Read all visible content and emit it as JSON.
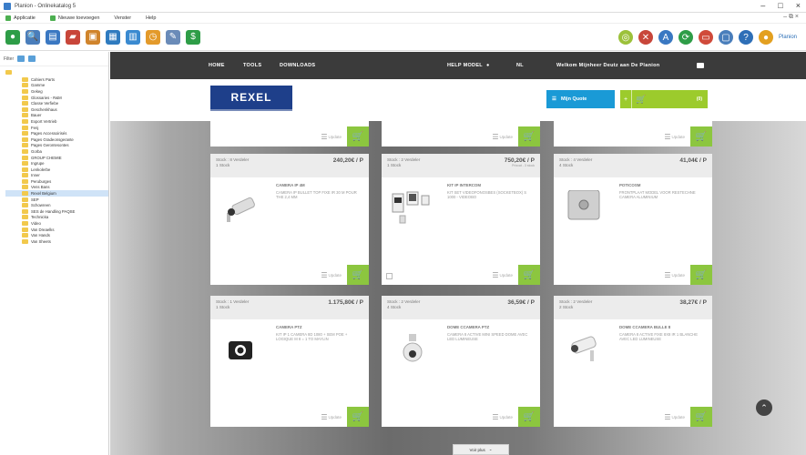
{
  "window": {
    "title": "Planion - Onlinekatalog 5",
    "controls": [
      "–",
      "□",
      "×"
    ]
  },
  "menu": {
    "items": [
      "Applicatie",
      "Nieuwe toevoegen",
      "Venster",
      "Help"
    ],
    "mdi_controls": "– ⧉ ×"
  },
  "toolbar": {
    "icons": [
      {
        "name": "home-icon",
        "color": "#2e9d47",
        "glyph": "●"
      },
      {
        "name": "search-icon",
        "color": "#4a7ebb",
        "glyph": "🔍"
      },
      {
        "name": "catalog-icon",
        "color": "#3a78c2",
        "glyph": "▤"
      },
      {
        "name": "truck-icon",
        "color": "#c8463a",
        "glyph": "▰"
      },
      {
        "name": "package-icon",
        "color": "#d0842c",
        "glyph": "▣"
      },
      {
        "name": "grid-icon",
        "color": "#2f7bbf",
        "glyph": "▦"
      },
      {
        "name": "chart-icon",
        "color": "#3a8ad0",
        "glyph": "▥"
      },
      {
        "name": "clock-icon",
        "color": "#e39a2b",
        "glyph": "◷"
      },
      {
        "name": "edit-icon",
        "color": "#6a8bb8",
        "glyph": "✎"
      },
      {
        "name": "currency-icon",
        "color": "#2e9d47",
        "glyph": "$"
      }
    ],
    "right_icons": [
      {
        "name": "lifebuoy-icon",
        "color": "#9cc13a",
        "glyph": "◎"
      },
      {
        "name": "cancel-icon",
        "color": "#c8463a",
        "glyph": "✕"
      },
      {
        "name": "language-icon",
        "color": "#3a78c2",
        "glyph": "A"
      },
      {
        "name": "sync-icon",
        "color": "#2e9d47",
        "glyph": "⟳"
      },
      {
        "name": "calendar-icon",
        "color": "#d04a3a",
        "glyph": "▭"
      },
      {
        "name": "document-icon",
        "color": "#4a7ebb",
        "glyph": "▢"
      },
      {
        "name": "help-icon",
        "color": "#2e6fb7",
        "glyph": "?"
      },
      {
        "name": "plugin-icon",
        "color": "#e3a020",
        "glyph": "●"
      }
    ],
    "right_label": "Planion"
  },
  "tree": {
    "filter_label": "Filter",
    "root_label": "",
    "items": [
      "Cahiers Parts",
      "Gamme",
      "Gekeg",
      "Glossaries - R&M",
      "Classe Verfiebe",
      "Geschenkhaus",
      "Bauer",
      "Export Vertrieb",
      "Fenj",
      "Pages Accessoirisés",
      "Pages Gradeonsgerante",
      "Pages Gerontesontes",
      "Gorba",
      "GROUP CHEMIE",
      "Ingrupe",
      "Lenkolerbe",
      "Inner",
      "Peruburges",
      "Vens Bans",
      "Rexel Belgium",
      "SEP",
      "Schowreen",
      "SES de Handling PAQSE",
      "Technicka",
      "Video",
      "Van Dreaelks",
      "Van Hands",
      "Van Sheets"
    ],
    "selected_index": 19
  },
  "nav": {
    "home": "HOME",
    "tools": "TOOLS",
    "downloads": "DOWNLOADS",
    "help": "HELP MODEL",
    "lang": "NL",
    "welcome": "Welkom Mijnheer Deutz aan De Planion"
  },
  "header": {
    "logo": "REXEL",
    "my_quote": "Mijn Quote",
    "cart_count": "(0)"
  },
  "cards": [
    {
      "stock": "Stock : 8 Verdeler",
      "stock2": "1 Stock",
      "price": "240,20€ / P",
      "price_note": "",
      "ref": "CAMERA IP 4M",
      "desc": "CAMERA IP BULLET TOP FIXE IR 30 M POUR THE 2,4 MM",
      "img": "camera-bullet"
    },
    {
      "stock": "Stock : 2 Verdeler",
      "stock2": "1 Stock",
      "price": "750,20€ / P",
      "price_note": "Prixcat - 3 stock",
      "ref": "KIT IP INTERCOM",
      "desc": "KIT SET VIDEOFONOSBES (SOCKETBOX) S 1000 - VIDEOBO",
      "img": "intercom-kit"
    },
    {
      "stock": "Stock : 4 Verdeler",
      "stock2": "4 Stock",
      "price": "41,04€ / P",
      "price_note": "",
      "ref": "POTICOSM",
      "desc": "FRONTPLAAT MODEL VOOR RESTECHNE CAMERA ALUMINIUM",
      "img": "front-plate"
    },
    {
      "stock": "Stock : 1 Verdeler",
      "stock2": "1 Stock",
      "price": "1.175,80€ / P",
      "price_note": "",
      "ref": "CAMERA PTZ",
      "desc": "KIT IP 1 CAMERA 8D 1080 + SEM POE + LOGIQUE M 8 = 1 TO MAYLIN",
      "img": "camera-box"
    },
    {
      "stock": "Stock : 2 Verdeler",
      "stock2": "4 Stock",
      "price": "36,59€ / P",
      "price_note": "",
      "ref": "DOME CCAMERA PTZ",
      "desc": "CAMERA 8 ACTIVE MINI SPEED DOME AVEC LED LUMINEUSE",
      "img": "dome-ptz"
    },
    {
      "stock": "Stock : 2 Verdeler",
      "stock2": "2 Stock",
      "price": "38,27€ / P",
      "price_note": "",
      "ref": "DOME CCAMERA BULLE 8",
      "desc": "CAMERA 8 ACTIVE FIXE 8X8 IR 1 BLANCHE AVEC LED LUMINEUSE",
      "img": "camera-white"
    }
  ],
  "card_labels": {
    "update": "Update"
  },
  "show_more": "Voir plus",
  "colors": {
    "accent_green": "#8cc63f",
    "accent_blue": "#1a9ad6",
    "nav_dark": "#3b3b3b",
    "logo_blue": "#1e3f8a"
  }
}
